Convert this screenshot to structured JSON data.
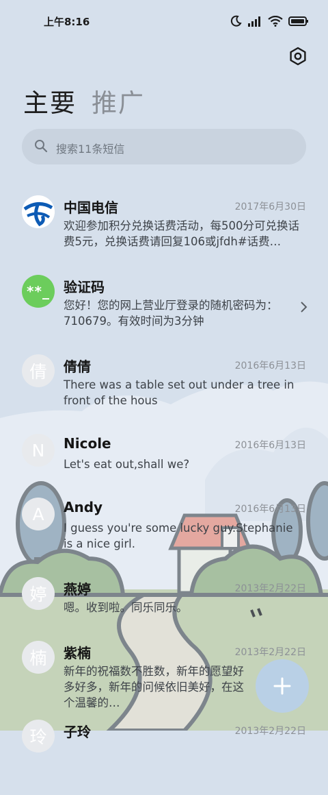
{
  "status_bar": {
    "time": "上午8:16"
  },
  "tabs": [
    {
      "label": "主要"
    },
    {
      "label": "推广"
    }
  ],
  "search": {
    "placeholder": "搜索11条短信"
  },
  "messages": [
    {
      "avatar": "telecom-logo",
      "name": "中国电信",
      "date": "2017年6月30日",
      "preview": "欢迎参加积分兑换话费活动，每500分可兑换话费5元，兑换话费请回复106或jfdh#话费…"
    },
    {
      "avatar_text": "**_",
      "name": "验证码",
      "date": "",
      "preview": "您好！您的网上营业厅登录的随机密码为：710679。有效时间为3分钟"
    },
    {
      "avatar_text": "倩",
      "name": "倩倩",
      "date": "2016年6月13日",
      "preview": "There was a table set out under a tree in front of the hous"
    },
    {
      "avatar_text": "N",
      "name": "Nicole",
      "date": "2016年6月13日",
      "preview": "Let's eat out,shall we?"
    },
    {
      "avatar_text": "A",
      "name": "Andy",
      "date": "2016年6月13日",
      "preview": "I guess you're some lucky guy.Stephanie is a nice girl."
    },
    {
      "avatar_text": "婷",
      "name": "燕婷",
      "date": "2013年2月22日",
      "preview": "嗯。收到啦。同乐同乐。"
    },
    {
      "avatar_text": "楠",
      "name": "紫楠",
      "date": "2013年2月22日",
      "preview": "新年的祝福数不胜数，新年的愿望好多好多，新年的问候依旧美好，在这个温馨的…"
    },
    {
      "avatar_text": "玲",
      "name": "子玲",
      "date": "2013年2月22日",
      "preview": ""
    }
  ],
  "fab": {
    "label": "+"
  },
  "colors": {
    "accent": "#b9d0e6",
    "verify_avatar": "#6ccd5c",
    "telecom_blue": "#0d5bb5"
  }
}
